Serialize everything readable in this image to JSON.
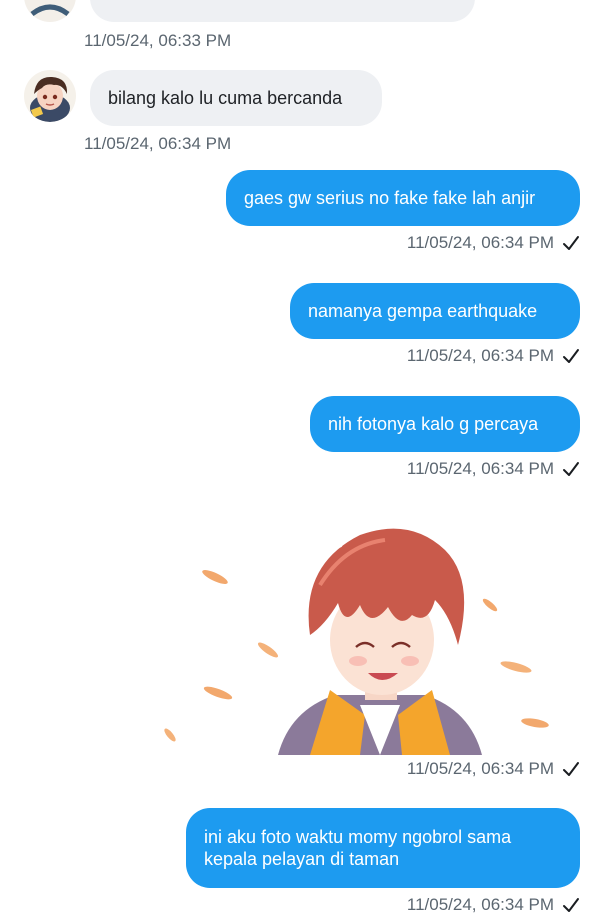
{
  "colors": {
    "outgoing_bubble": "#1d9bf0",
    "incoming_bubble": "#eef0f3",
    "timestamp": "#5b6670",
    "background": "#ffffff"
  },
  "messages": [
    {
      "direction": "incoming",
      "text": "",
      "timestamp": "11/05/24, 06:33 PM"
    },
    {
      "direction": "incoming",
      "text": "bilang kalo lu cuma bercanda",
      "timestamp": "11/05/24, 06:34 PM"
    },
    {
      "direction": "outgoing",
      "text": "gaes gw serius no fake fake lah anjir",
      "timestamp": "11/05/24, 06:34 PM",
      "status_icon": "check-icon"
    },
    {
      "direction": "outgoing",
      "text": "namanya gempa earthquake",
      "timestamp": "11/05/24, 06:34 PM",
      "status_icon": "check-icon"
    },
    {
      "direction": "outgoing",
      "text": "nih fotonya kalo g percaya",
      "timestamp": "11/05/24, 06:34 PM",
      "status_icon": "check-icon"
    },
    {
      "direction": "outgoing",
      "type": "image",
      "image": "anime-boy-illustration",
      "timestamp": "11/05/24, 06:34 PM",
      "status_icon": "check-icon"
    },
    {
      "direction": "outgoing",
      "text": "ini aku foto waktu momy ngobrol sama kepala pelayan di taman",
      "timestamp": "11/05/24, 06:34 PM",
      "status_icon": "check-icon"
    }
  ]
}
